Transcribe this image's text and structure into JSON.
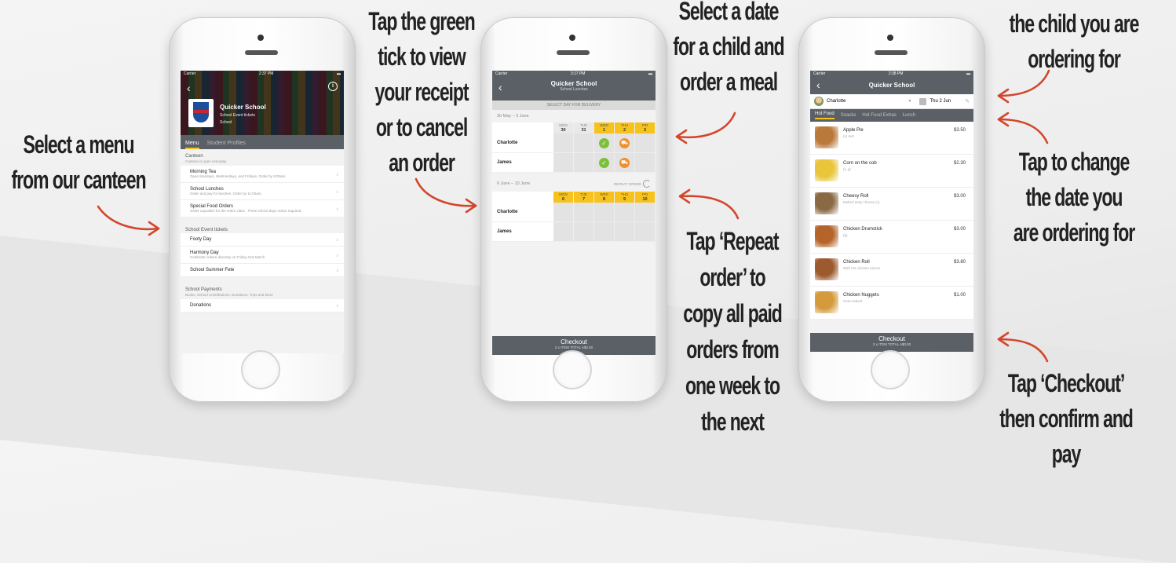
{
  "callouts": {
    "menu": [
      "Select a menu",
      "from our canteen"
    ],
    "tick": [
      "Tap the green",
      "tick to view",
      "your receipt",
      "or to cancel",
      "an order"
    ],
    "date": [
      "Select a date",
      "for a child and",
      "order a meal"
    ],
    "repeat": [
      "Tap ‘Repeat",
      "order’ to",
      "copy all paid",
      "orders from",
      "one week to",
      "the next"
    ],
    "child": [
      "the child you are",
      "ordering for"
    ],
    "change_date": [
      "Tap to change",
      "the date you",
      "are ordering for"
    ],
    "checkout": [
      "Tap ‘Checkout’",
      "then confirm and pay"
    ]
  },
  "phone1": {
    "status": {
      "carrier": "Carrier",
      "time": "2:37 PM"
    },
    "school_name": "Quicker School",
    "school_line1": "School Event tickets",
    "school_line2": "School",
    "tabs": [
      "Menu",
      "Student Profiles"
    ],
    "canteen": {
      "title": "Canteen",
      "subtitle": "Canteen is open everyday",
      "items": [
        {
          "title": "Morning Tea",
          "desc": "Open Mondays, Wednesdays, and Fridays. Order by 9:00am."
        },
        {
          "title": "School Lunches",
          "desc": "Order and pay for lunches. Order by 11:00am."
        },
        {
          "title": "Special Food Orders",
          "desc": "Order cupcakes for the entire class . Three school days notice required."
        }
      ]
    },
    "events": {
      "title": "School Event tickets",
      "items": [
        {
          "title": "Footy Day",
          "desc": ""
        },
        {
          "title": "Harmony Day",
          "desc": "Celebrate culture diversity on Friday 21st March"
        },
        {
          "title": "School Summer Fete",
          "desc": ""
        }
      ]
    },
    "payments": {
      "title": "School Payments",
      "subtitle": "Books, School Contributions, Donations, Trips and More",
      "items": [
        {
          "title": "Donations",
          "desc": ""
        }
      ]
    }
  },
  "phone2": {
    "status": {
      "carrier": "Carrier",
      "time": "3:17 PM"
    },
    "title": "Quicker School",
    "subtitle": "School Lunches",
    "subbar": "SELECT DAY FOR DELIVERY",
    "week1": {
      "range": "30 May – 3 June",
      "days": [
        {
          "dow": "MON",
          "date": "30",
          "active": false
        },
        {
          "dow": "TUE",
          "date": "31",
          "active": false
        },
        {
          "dow": "WED",
          "date": "1",
          "active": true
        },
        {
          "dow": "THU",
          "date": "2",
          "active": true
        },
        {
          "dow": "FRI",
          "date": "3",
          "active": true
        }
      ],
      "rows": [
        {
          "name": "Charlotte",
          "slots": [
            "",
            "",
            "tick",
            "cart",
            ""
          ]
        },
        {
          "name": "James",
          "slots": [
            "",
            "",
            "tick",
            "cart",
            ""
          ]
        }
      ]
    },
    "week2": {
      "range": "6 June – 10 June",
      "repeat_label": "REPEAT ORDER",
      "days": [
        {
          "dow": "MON",
          "date": "6",
          "active": true
        },
        {
          "dow": "TUE",
          "date": "7",
          "active": true
        },
        {
          "dow": "WED",
          "date": "8",
          "active": true
        },
        {
          "dow": "THU",
          "date": "9",
          "active": true
        },
        {
          "dow": "FRI",
          "date": "10",
          "active": true
        }
      ],
      "rows": [
        {
          "name": "Charlotte",
          "slots": [
            "",
            "",
            "",
            "",
            ""
          ]
        },
        {
          "name": "James",
          "slots": [
            "",
            "",
            "",
            "",
            ""
          ]
        }
      ]
    },
    "checkout": {
      "label": "Checkout",
      "summary": "2 x ITEM  TOTAL A$0.00"
    }
  },
  "phone3": {
    "status": {
      "carrier": "Carrier",
      "time": "2:38 PM"
    },
    "title": "Quicker School",
    "child": "Charlotte",
    "date": "Thu 2 Jun",
    "tabs": [
      "Hot Food",
      "Snacks",
      "Hot Food Extras",
      "Lunch"
    ],
    "items": [
      {
        "name": "Apple Pie",
        "desc": "(v) test",
        "price": "$3.50",
        "color": "#b9793a"
      },
      {
        "name": "Corn on the cob",
        "desc": "(v, g)",
        "price": "$2.30",
        "color": "#e8c53a"
      },
      {
        "name": "Cheesy Roll",
        "desc": "Melted tasty cheese (v)",
        "price": "$3.00",
        "color": "#8a6a44"
      },
      {
        "name": "Chicken Drumstick",
        "desc": "(g)",
        "price": "$3.00",
        "color": "#b4642a"
      },
      {
        "name": "Chicken Roll",
        "desc": "With hot chicken pieces",
        "price": "$3.80",
        "color": "#9c5a2e"
      },
      {
        "name": "Chicken Nuggets",
        "desc": "Oven baked",
        "price": "$1.00",
        "color": "#d49a3c"
      }
    ],
    "checkout": {
      "label": "Checkout",
      "summary": "2 x ITEM  TOTAL A$0.00"
    }
  },
  "colors": {
    "accent": "#f6c21b",
    "arrow": "#d2472c",
    "nav": "#5a6066",
    "tick": "#7cbf3b",
    "cart": "#f1902a"
  }
}
